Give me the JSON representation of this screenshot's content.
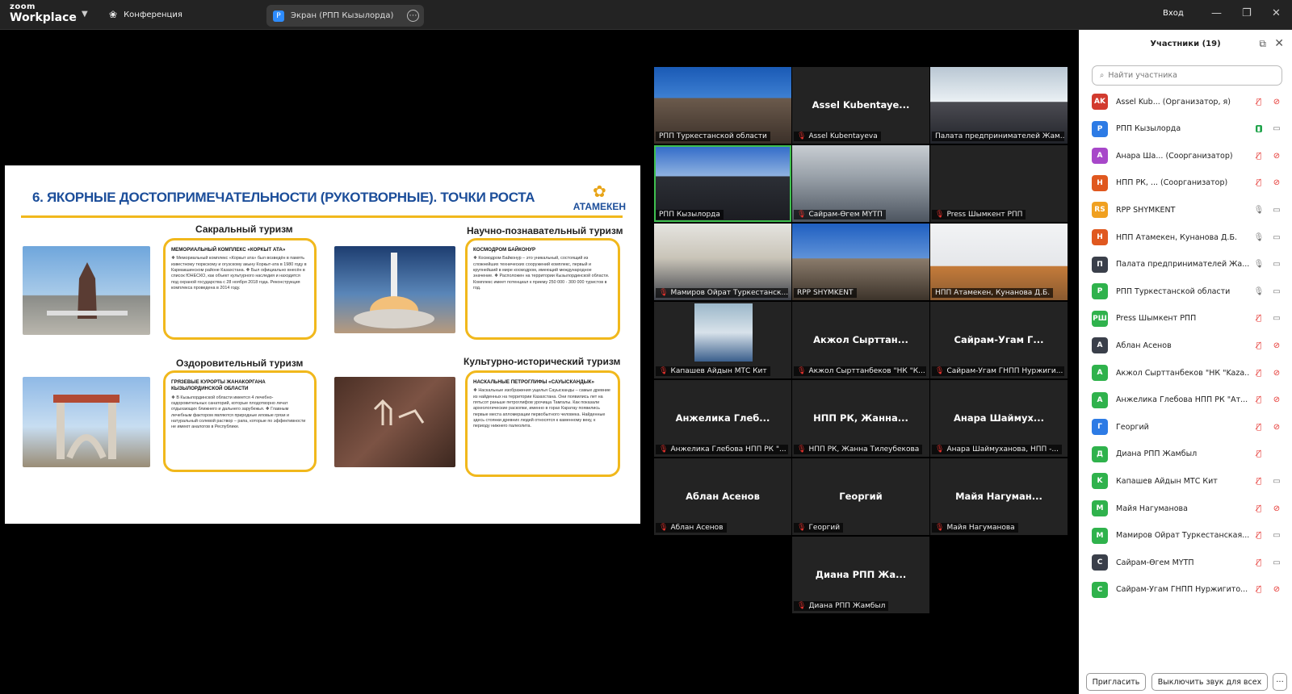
{
  "topbar": {
    "logo_small": "zoom",
    "logo_main": "Workplace",
    "conference_label": "Конференция",
    "screen_badge": "P",
    "screen_tab_label": "Экран (РПП Кызылорда)",
    "login_label": "Вход"
  },
  "slide": {
    "title": "6. ЯКОРНЫЕ ДОСТОПРИМЕЧАТЕЛЬНОСТИ (РУКОТВОРНЫЕ). ТОЧКИ РОСТА",
    "logo_text": "АТАМЕКЕН",
    "sections": {
      "sacral": "Сакральный туризм",
      "science": "Научно-познавательный туризм",
      "health": "Оздоровительный туризм",
      "culture": "Культурно-исторический туризм"
    },
    "boxes": [
      {
        "head": "МЕМОРИАЛЬНЫЙ КОМПЛЕКС «КОРКЫТ АТА»",
        "body": "❖ Мемориальный комплекс «Коркыт ата» был возведён в память известному тюркскому и огузскому акыну Коркыт-ата в 1980 году в Кармакшинском районе Казахстана. ❖ Был официально внесён в список ЮНЕСКО, как объект культурного наследия и находится под охраной государства с 28 ноября 2018 года. Реконструкция комплекса проведена в 2014 году."
      },
      {
        "head": "КОСМОДРОМ БАЙКОНУР",
        "body": "❖ Космодром Байконур – это уникальный, состоящий из сложнейших технических сооружений комплекс, первый и крупнейший в мире космодром, имеющий международное значение. ❖ Расположен на территории Кызылординской области. Комплекс имеет потенциал к приему 250 000 - 300 000 туристов в год."
      },
      {
        "head": "ГРЯЗЕВЫЕ КУРОРТЫ ЖАНАКОРГАНА КЫЗЫЛОРДИНСКОЙ ОБЛАСТИ",
        "body": "❖ В Кызылординской области имеется 4 лечебно-оздоровительных санаторий, которые плодотворно лечат отдыхающих ближнего и дальнего зарубежья. ❖ Главным лечебным фактором являются природные иловые грязи и натуральный солевой раствор – рапа, которые по эффективности не имеют аналогов в Республике."
      },
      {
        "head": "НАСКАЛЬНЫЕ ПЕТРОГЛИФЫ «САУЫСКАНДЫК»",
        "body": "❖ Наскальные изображения ущелья Сауысканды – самые древние из найденных на территории Казахстана. Они появились лет на пятьсот раньше петроглифов урочища Тамгалы. Как показали археологические раскопки, именно в горах Каратау появились первые места апломерации первобытного человека. Найденные здесь стоянки древних людей относятся к каменному веку, к периоду нижнего палеолита."
      }
    ]
  },
  "tiles": [
    {
      "center": "",
      "label": "РПП Туркестанской области",
      "muted": false,
      "video": true
    },
    {
      "center": "Assel Kubentaye...",
      "label": "Assel Kubentayeva",
      "muted": true,
      "video": false
    },
    {
      "center": "",
      "label": "Палата предпринимателей Жам...",
      "muted": false,
      "video": true
    },
    {
      "center": "",
      "label": "РПП Кызылорда",
      "muted": false,
      "video": true
    },
    {
      "center": "",
      "label": "Сайрам-Өгем МҮТП",
      "muted": true,
      "video": true
    },
    {
      "center": "",
      "label": "Press Шымкент РПП",
      "muted": true,
      "video": false
    },
    {
      "center": "",
      "label": "Мамиров Ойрат Туркестанск...",
      "muted": true,
      "video": true
    },
    {
      "center": "",
      "label": "RPP SHYMKENT",
      "muted": false,
      "video": true
    },
    {
      "center": "",
      "label": "НПП Атамекен, Кунанова Д.Б.",
      "muted": false,
      "video": true
    },
    {
      "center": "",
      "label": "Капашев Айдын МТС Кит",
      "muted": true,
      "video": true
    },
    {
      "center": "Акжол Сырттан...",
      "label": "Акжол Сырттанбеков \"НК \"К...",
      "muted": true,
      "video": false
    },
    {
      "center": "Сайрам-Угам Г...",
      "label": "Сайрам-Угам ГНПП Нуржиги...",
      "muted": true,
      "video": false
    },
    {
      "center": "Анжелика Глеб...",
      "label": "Анжелика Глебова НПП РК \"...",
      "muted": true,
      "video": false
    },
    {
      "center": "НПП РК, Жанна...",
      "label": "НПП РК, Жанна Тилеубекова",
      "muted": true,
      "video": false
    },
    {
      "center": "Анара Шаймух...",
      "label": "Анара Шаймуханова, НПП -...",
      "muted": true,
      "video": false
    },
    {
      "center": "Аблан Асенов",
      "label": "Аблан Асенов",
      "muted": true,
      "video": false
    },
    {
      "center": "Георгий",
      "label": "Георгий",
      "muted": true,
      "video": false
    },
    {
      "center": "Майя Нагуман...",
      "label": "Майя Нагуманова",
      "muted": true,
      "video": false
    },
    {
      "center": "Диана РПП Жа...",
      "label": "Диана РПП Жамбыл",
      "muted": true,
      "video": false
    }
  ],
  "panel": {
    "title": "Участники (19)",
    "search_placeholder": "Найти участника",
    "invite_label": "Пригласить",
    "muteall_label": "Выключить звук для всех",
    "more_label": "···",
    "participants": [
      {
        "initials": "AK",
        "color": "#d23b2f",
        "name": "Assel Kub...  (Организатор, я)",
        "mic": "red",
        "cam": "red"
      },
      {
        "initials": "P",
        "color": "#2d7be5",
        "name": "РПП Кызылорда",
        "mic": "green",
        "cam": "gray"
      },
      {
        "initials": "A",
        "color": "#a747c9",
        "name": "Анара Ша...  (Соорганизатор)",
        "mic": "red",
        "cam": "red"
      },
      {
        "initials": "H",
        "color": "#e0581f",
        "name": "НПП РК, ...  (Соорганизатор)",
        "mic": "red",
        "cam": "red"
      },
      {
        "initials": "RS",
        "color": "#f0a020",
        "name": "RPP SHYMKENT",
        "mic": "gray",
        "cam": "gray"
      },
      {
        "initials": "H",
        "color": "#e0581f",
        "name": "НПП Атамекен, Кунанова Д.Б.",
        "mic": "gray",
        "cam": "gray"
      },
      {
        "initials": "П",
        "color": "#3a3f4a",
        "name": "Палата предпринимателей Жа...",
        "mic": "gray",
        "cam": "gray"
      },
      {
        "initials": "P",
        "color": "#2fb24c",
        "name": "РПП Туркестанской области",
        "mic": "gray",
        "cam": "gray"
      },
      {
        "initials": "PШ",
        "color": "#2fb24c",
        "name": "Press Шымкент РПП",
        "mic": "red",
        "cam": "gray"
      },
      {
        "initials": "A",
        "color": "#3a3f4a",
        "name": "Аблан Асенов",
        "mic": "red",
        "cam": "red"
      },
      {
        "initials": "A",
        "color": "#2fb24c",
        "name": "Акжол Сырттанбеков \"НК \"Kaza...",
        "mic": "red",
        "cam": "red"
      },
      {
        "initials": "A",
        "color": "#2fb24c",
        "name": "Анжелика Глебова НПП РК \"Ат...",
        "mic": "red",
        "cam": "red"
      },
      {
        "initials": "Г",
        "color": "#2d7be5",
        "name": "Георгий",
        "mic": "red",
        "cam": "red"
      },
      {
        "initials": "Д",
        "color": "#2fb24c",
        "name": "Диана РПП Жамбыл",
        "mic": "red",
        "cam": ""
      },
      {
        "initials": "K",
        "color": "#2fb24c",
        "name": "Капашев Айдын МТС Кит",
        "mic": "red",
        "cam": "gray"
      },
      {
        "initials": "M",
        "color": "#2fb24c",
        "name": "Майя Нагуманова",
        "mic": "red",
        "cam": "red"
      },
      {
        "initials": "M",
        "color": "#2fb24c",
        "name": "Мамиров Ойрат Туркестанская...",
        "mic": "red",
        "cam": "gray"
      },
      {
        "initials": "C",
        "color": "#3a3f4a",
        "name": "Сайрам-Өгем МҮТП",
        "mic": "red",
        "cam": "gray"
      },
      {
        "initials": "C",
        "color": "#2fb24c",
        "name": "Сайрам-Угам ГНПП Нуржигито...",
        "mic": "red",
        "cam": "red"
      }
    ]
  }
}
